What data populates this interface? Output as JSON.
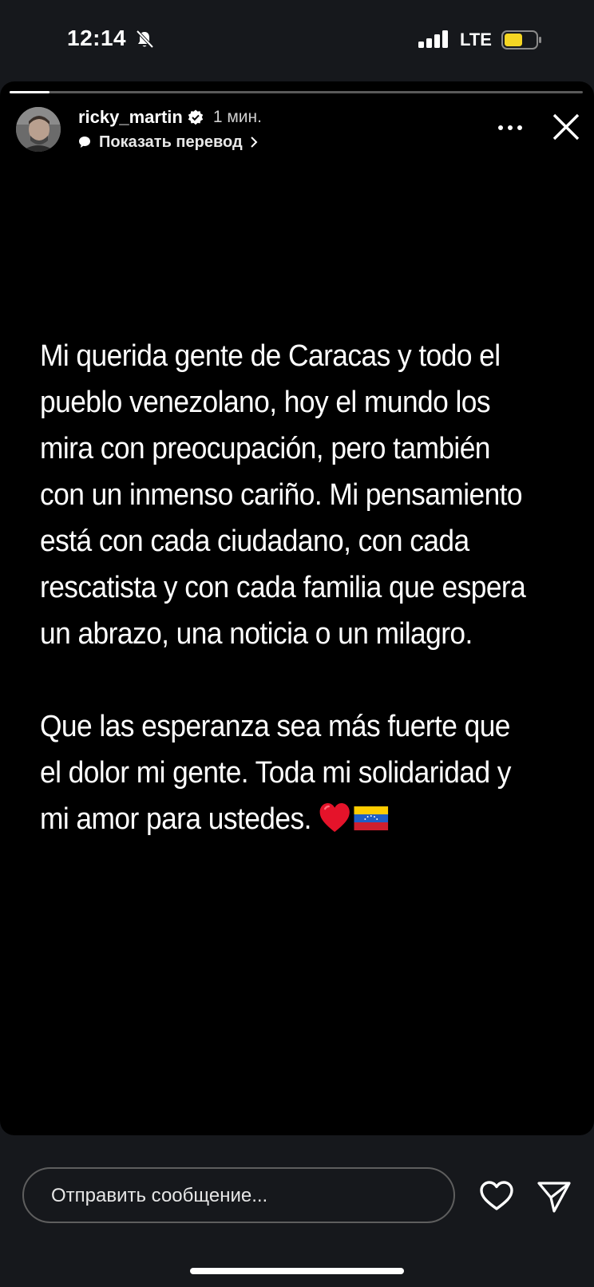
{
  "status_bar": {
    "time": "12:14",
    "network": "LTE",
    "mute_icon": "bell-slash-icon",
    "battery_color": "#f5d623"
  },
  "story": {
    "progress": 0.07,
    "username": "ricky_martin",
    "verified": true,
    "time_ago": "1 мин.",
    "translate_label": "Показать перевод",
    "paragraphs": [
      "Mi querida gente de Caracas y todo el pueblo venezolano, hoy el mundo los mira con preocupación, pero también con un inmenso cariño. Mi pensamiento está con cada ciudadano, con cada rescatista y con cada familia que espera un abrazo, una noticia o un milagro.",
      "Que las esperanza sea más fuerte que el dolor mi gente. Toda mi solidaridad y mi amor para ustedes."
    ],
    "emojis": [
      "red-heart",
      "venezuela-flag"
    ]
  },
  "footer": {
    "reply_placeholder": "Отправить сообщение...",
    "icons": [
      "heart-icon",
      "send-icon"
    ]
  }
}
